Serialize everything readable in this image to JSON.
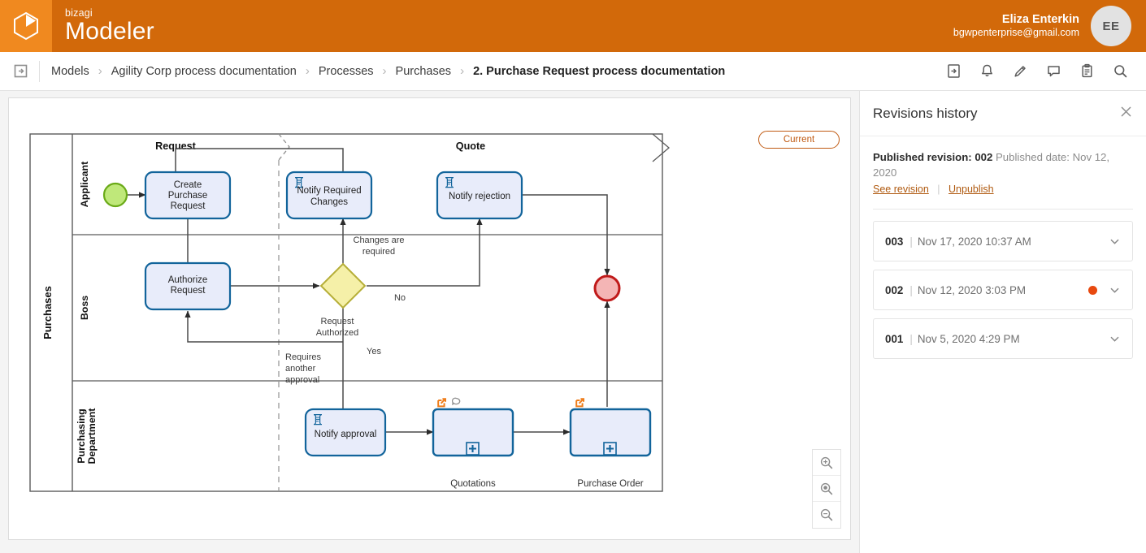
{
  "header": {
    "brand_sub": "bizagi",
    "brand_main": "Modeler",
    "logo_icon": "bizagi-cube-icon",
    "user_name": "Eliza Enterkin",
    "user_email": "bgwpenterprise@gmail.com",
    "avatar_initials": "EE",
    "bg_color": "#d2690a",
    "logo_bg_color": "#f0891f"
  },
  "breadcrumb": {
    "toggle_icon": "panel-toggle-icon",
    "separator": "›",
    "items": [
      {
        "label": "Models"
      },
      {
        "label": "Agility Corp process documentation"
      },
      {
        "label": "Processes"
      },
      {
        "label": "Purchases"
      },
      {
        "label": "2. Purchase Request process documentation"
      }
    ],
    "tools": [
      {
        "name": "document-icon"
      },
      {
        "name": "bell-icon"
      },
      {
        "name": "pencil-icon"
      },
      {
        "name": "comment-icon"
      },
      {
        "name": "clipboard-icon"
      },
      {
        "name": "search-icon"
      }
    ]
  },
  "canvas": {
    "current_badge": "Current",
    "zoom_controls": [
      {
        "name": "zoom-in-icon"
      },
      {
        "name": "zoom-reset-icon"
      },
      {
        "name": "zoom-out-icon"
      }
    ],
    "diagram": {
      "pool": "Purchases",
      "lanes": [
        "Applicant",
        "Boss",
        "Purchasing Department"
      ],
      "phases": [
        "Request",
        "Quote"
      ],
      "tasks": [
        {
          "id": "create",
          "label": "Create Purchase Request",
          "type": "task"
        },
        {
          "id": "notify_changes",
          "label": "Notify Required Changes",
          "type": "script-task"
        },
        {
          "id": "notify_rejection",
          "label": "Notify rejection",
          "type": "script-task"
        },
        {
          "id": "authorize",
          "label": "Authorize Request",
          "type": "task"
        },
        {
          "id": "notify_approval",
          "label": "Notify approval",
          "type": "script-task"
        },
        {
          "id": "quotations",
          "label": "Quotations",
          "type": "subprocess"
        },
        {
          "id": "purchase_order",
          "label": "Purchase Order",
          "type": "subprocess"
        }
      ],
      "gateway": {
        "label": "Request Authorized"
      },
      "flow_labels": [
        "Changes are required",
        "No",
        "Yes",
        "Requires another approval"
      ],
      "events": [
        {
          "name": "start-event",
          "type": "start"
        },
        {
          "name": "end-event",
          "type": "end"
        }
      ],
      "markers": {
        "link_icon": "external-link-icon",
        "comment_icon": "comment-bubble-icon",
        "subprocess_icon": "plus-box-icon"
      },
      "colors": {
        "task_fill": "#e8ecfa",
        "task_stroke": "#12649b",
        "gateway_fill": "#f5f0a8",
        "gateway_stroke": "#b6ae38",
        "start_fill": "#bfe87a",
        "start_stroke": "#6aaa18",
        "end_fill": "#f4b5b5",
        "end_stroke": "#c01a1a",
        "marker_orange": "#ef7d1a"
      }
    }
  },
  "revisions_panel": {
    "title": "Revisions history",
    "close_icon": "close-icon",
    "published_prefix": "Published revision:",
    "published_revision": "002",
    "published_date_prefix": "Published date:",
    "published_date": "Nov 12, 2020",
    "see_revision": "See revision",
    "unpublish": "Unpublish",
    "separator": "|",
    "revisions": [
      {
        "number": "003",
        "sep": "|",
        "date": "Nov 17, 2020 10:37 AM",
        "published": false,
        "chevron": "chevron-down-icon"
      },
      {
        "number": "002",
        "sep": "|",
        "date": "Nov 12, 2020 3:03 PM",
        "published": true,
        "chevron": "chevron-down-icon"
      },
      {
        "number": "001",
        "sep": "|",
        "date": "Nov 5, 2020 4:29 PM",
        "published": false,
        "chevron": "chevron-down-icon"
      }
    ],
    "dot_color": "#e8490f"
  }
}
